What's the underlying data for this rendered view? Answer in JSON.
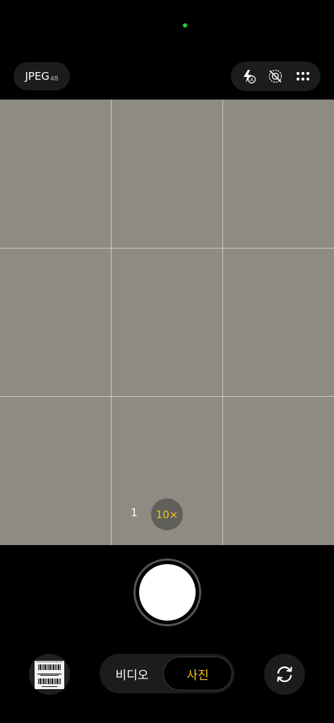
{
  "top_bar": {
    "format_label": "JPEG",
    "format_megapixels": "48"
  },
  "quick_settings": {
    "icons": [
      "flash-auto-icon",
      "motion-photo-off-icon",
      "more-options-icon"
    ]
  },
  "viewfinder": {
    "grid": "3x3",
    "background_color": "#8d8b82"
  },
  "zoom": {
    "options": [
      "1",
      "10×"
    ],
    "selected": "10×"
  },
  "modes": {
    "video_label": "비디오",
    "photo_label": "사진",
    "selected": "사진"
  },
  "colors": {
    "accent": "#f2c31c",
    "privacy_indicator": "#2ecc40"
  }
}
